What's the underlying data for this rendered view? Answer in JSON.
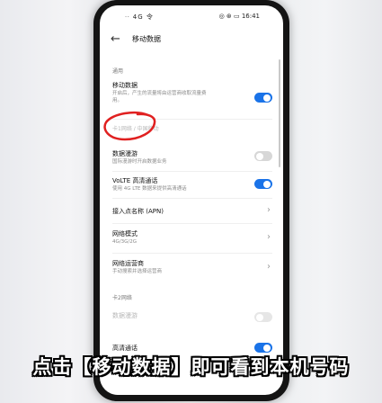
{
  "statusbar": {
    "left": "ᐧᐧ 4G 令",
    "right": "◎ ⊛ ▭ 16:41"
  },
  "header": {
    "title": "移动数据"
  },
  "sections": {
    "general": "通用",
    "sim2": "卡2网络"
  },
  "rows": {
    "mobile_data": {
      "label": "移动数据",
      "desc1": "开启后，产生的流量将由运营商收取流量费",
      "desc2": "用。",
      "toggle": true
    },
    "sim1": {
      "label": "卡1网络 ∕ 中国移动"
    },
    "roaming": {
      "label": "数据漫游",
      "desc": "国际漫游时开启数据业务",
      "toggle": false
    },
    "volte": {
      "label": "VoLTE 高清通话",
      "desc": "使用 4G LTE 数据来提供高清通话",
      "toggle": true
    },
    "apn": {
      "label": "接入点名称 (APN)"
    },
    "network_mode": {
      "label": "网络模式",
      "desc": "4G/3G/2G"
    },
    "operator": {
      "label": "网络运营商",
      "desc": "手动搜索并选择运营商"
    },
    "sim2_data": {
      "label": "数据漫游",
      "toggle": false
    },
    "sim2_volte": {
      "label": "高清通话",
      "toggle": true
    }
  },
  "caption": "点击【移动数据】即可看到本机号码",
  "colors": {
    "accent": "#1a73e8",
    "annotation": "#e02020"
  }
}
